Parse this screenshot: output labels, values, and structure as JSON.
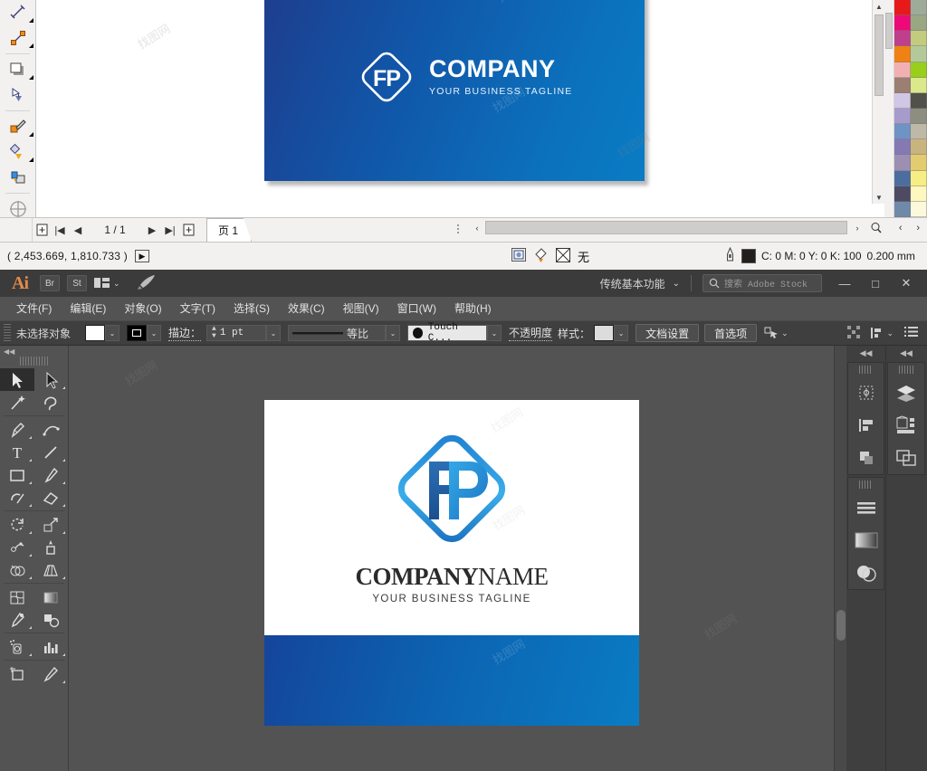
{
  "top_app": {
    "toolbar_tools": [
      {
        "name": "dimension-tool",
        "flyout": true
      },
      {
        "name": "connector-tool",
        "flyout": true
      },
      {
        "name": "drop-shadow-tool",
        "flyout": true
      },
      {
        "name": "transparency-tool",
        "flyout": false
      },
      {
        "name": "color-eyedropper-tool",
        "flyout": true
      },
      {
        "name": "interactive-fill-tool",
        "flyout": true
      },
      {
        "name": "smart-fill-tool",
        "flyout": false
      },
      {
        "name": "zoom-crosshair-tool",
        "flyout": false
      }
    ],
    "document": {
      "card_logo_monogram": "FP",
      "card_company": "COMPANY",
      "card_tagline": "YOUR BUSINESS TAGLINE"
    },
    "page_nav": {
      "add_page_before_title": "Add page before",
      "first_label": "|◀",
      "prev_label": "◀",
      "counter": "1 / 1",
      "next_label": "▶",
      "last_label": "▶|",
      "add_page_after_title": "Add page after",
      "tab_label": "页 1"
    },
    "status_bar": {
      "coordinates": "( 2,453.669, 1,810.733 )",
      "play_label": "▶",
      "fill_none_label": "无",
      "outline_color_info": "C: 0 M: 0 Y: 0 K: 100",
      "outline_width": "0.200 mm"
    },
    "palette_colors_left": [
      "#e8191a",
      "#ec0a78",
      "#bf3f8c",
      "#f08113",
      "#f3b0b3",
      "#9a7f72",
      "#cfc7e4",
      "#a79bcb",
      "#6f93c4",
      "#8579b4",
      "#9c8fb3",
      "#4b6e9e",
      "#4f4a63",
      "#6f89a8"
    ],
    "palette_colors_right": [
      "#9eaa9a",
      "#9aa783",
      "#c2cb7e",
      "#b4c99a",
      "#97cf1a",
      "#dbe88b",
      "#51504a",
      "#8d8d80",
      "#bdb9a6",
      "#c9b47e",
      "#e3cc70",
      "#f6ee84",
      "#fdf7c0",
      "#fcf8dc"
    ]
  },
  "illustrator": {
    "app_name": "Ai",
    "quick_apps": [
      {
        "name": "bridge-button",
        "label": "Br"
      },
      {
        "name": "stock-button",
        "label": "St"
      }
    ],
    "arrange_label": "",
    "workspace_label": "传统基本功能",
    "search_placeholder": "搜索 Adobe Stock",
    "window_buttons": {
      "minimize": "—",
      "maximize": "□",
      "close": "✕"
    },
    "menus": [
      "文件(F)",
      "编辑(E)",
      "对象(O)",
      "文字(T)",
      "选择(S)",
      "效果(C)",
      "视图(V)",
      "窗口(W)",
      "帮助(H)"
    ],
    "control_bar": {
      "selection_status": "未选择对象",
      "fill_color": "#ffffff",
      "stroke_color": "#000000",
      "stroke_label": "描边：",
      "stroke_weight": "1 pt",
      "profile_label": "等比",
      "brush_label": "Touch C...",
      "opacity_label": "不透明度",
      "style_label": "样式：",
      "doc_setup_button": "文档设置",
      "preferences_button": "首选项"
    },
    "tools": [
      {
        "name": "selection-tool",
        "active": true,
        "flyout": false
      },
      {
        "name": "direct-selection-tool",
        "active": false,
        "flyout": true
      },
      {
        "name": "magic-wand-tool",
        "active": false,
        "flyout": false
      },
      {
        "name": "lasso-tool",
        "active": false,
        "flyout": false
      },
      {
        "name": "pen-tool",
        "active": false,
        "flyout": true
      },
      {
        "name": "curvature-tool",
        "active": false,
        "flyout": false
      },
      {
        "name": "type-tool",
        "active": false,
        "flyout": true
      },
      {
        "name": "line-segment-tool",
        "active": false,
        "flyout": true
      },
      {
        "name": "rectangle-tool",
        "active": false,
        "flyout": true
      },
      {
        "name": "paintbrush-tool",
        "active": false,
        "flyout": true
      },
      {
        "name": "shaper-tool",
        "active": false,
        "flyout": true
      },
      {
        "name": "eraser-tool",
        "active": false,
        "flyout": true
      },
      {
        "name": "rotate-tool",
        "active": false,
        "flyout": true
      },
      {
        "name": "scale-tool",
        "active": false,
        "flyout": true
      },
      {
        "name": "width-tool",
        "active": false,
        "flyout": true
      },
      {
        "name": "free-transform-tool",
        "active": false,
        "flyout": false
      },
      {
        "name": "shape-builder-tool",
        "active": false,
        "flyout": true
      },
      {
        "name": "perspective-grid-tool",
        "active": false,
        "flyout": true
      },
      {
        "name": "mesh-tool",
        "active": false,
        "flyout": false
      },
      {
        "name": "gradient-tool",
        "active": false,
        "flyout": false
      },
      {
        "name": "eyedropper-tool",
        "active": false,
        "flyout": true
      },
      {
        "name": "blend-tool",
        "active": false,
        "flyout": false
      },
      {
        "name": "symbol-sprayer-tool",
        "active": false,
        "flyout": true
      },
      {
        "name": "column-graph-tool",
        "active": false,
        "flyout": true
      },
      {
        "name": "artboard-tool",
        "active": false,
        "flyout": false
      },
      {
        "name": "slice-tool",
        "active": false,
        "flyout": true
      }
    ],
    "artboard": {
      "logo_monogram": "FP",
      "company_name_bold": "COMPANY",
      "company_name_light": "NAME",
      "tagline": "YOUR BUSINESS TAGLINE"
    },
    "right_dock": {
      "col1": [
        {
          "name": "transform-panel-icon"
        },
        {
          "name": "align-panel-icon"
        },
        {
          "name": "pathfinder-panel-icon"
        },
        {
          "name": "stroke-panel-icon"
        },
        {
          "name": "gradient-panel-icon"
        },
        {
          "name": "transparency-panel-icon"
        }
      ],
      "col2": [
        {
          "name": "layers-panel-icon"
        },
        {
          "name": "libraries-panel-icon"
        },
        {
          "name": "artboards-panel-icon"
        }
      ]
    }
  },
  "watermark_text": "找图网"
}
